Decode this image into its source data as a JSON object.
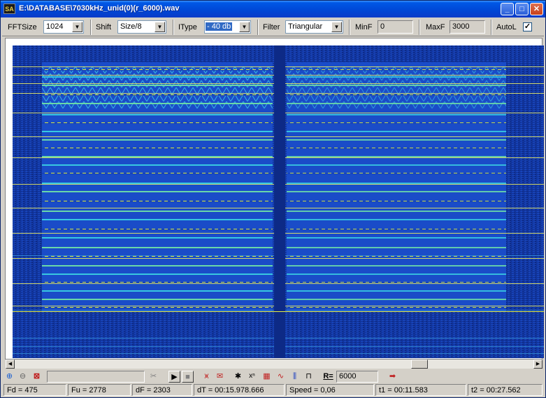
{
  "window": {
    "title": "E:\\DATABASE\\7030kHz_unid(0)(r_6000).wav",
    "app_icon": "SA"
  },
  "toolbar": {
    "fftsize_label": "FFTSize",
    "fftsize_value": "1024",
    "shift_label": "Shift",
    "shift_value": "Size/8",
    "itype_label": "IType",
    "itype_value": "- 40 db",
    "filter_label": "Filter",
    "filter_value": "Triangular",
    "minf_label": "MinF",
    "minf_value": "0",
    "maxf_label": "MaxF",
    "maxf_value": "3000",
    "autol_label": "AutoL",
    "autol_checked": "✓"
  },
  "bottom": {
    "r_label": "R=",
    "r_value": "6000"
  },
  "status": {
    "fd": "Fd = 475",
    "fu": "Fu = 2778",
    "df": "dF = 2303",
    "dt": "dT = 00:15.978.666",
    "speed": "Speed = 0,06",
    "t1": "t1 = 00:11.583",
    "t2": "t2 = 00:27.562"
  },
  "colors": {
    "title_bar": "#0046d5",
    "spectrogram_bg": "#0f2c8a",
    "signal_bright": "#e8f040",
    "signal_mid": "#30c8d8"
  }
}
